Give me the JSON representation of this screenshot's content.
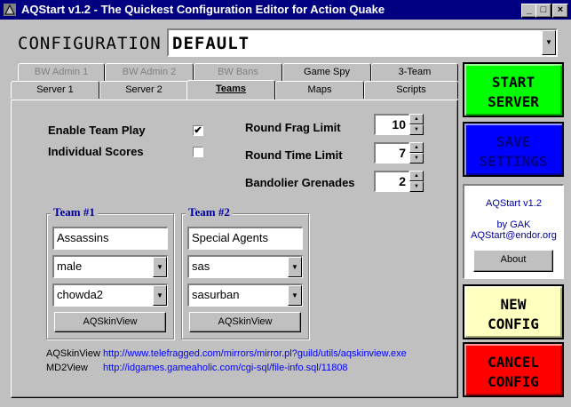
{
  "window": {
    "title": "AQStart v1.2 - The Quickest Configuration Editor for Action Quake",
    "minimize_icon": "minimize-icon",
    "maximize_icon": "maximize-icon",
    "close_icon": "close-icon"
  },
  "configuration": {
    "label": "CONFIGURATION",
    "value": "DEFAULT"
  },
  "tabs": {
    "row_back": [
      "BW Admin 1",
      "BW Admin 2",
      "BW Bans",
      "Game Spy",
      "3-Team"
    ],
    "row_front": [
      "Server 1",
      "Server 2",
      "Teams",
      "Maps",
      "Scripts"
    ],
    "active": "Teams"
  },
  "teams": {
    "enable_team_play_label": "Enable Team Play",
    "enable_team_play_checked": true,
    "individual_scores_label": "Individual Scores",
    "individual_scores_checked": false,
    "round_frag_limit_label": "Round Frag Limit",
    "round_frag_limit": "10",
    "round_time_limit_label": "Round Time Limit",
    "round_time_limit": "7",
    "bandolier_grenades_label": "Bandolier Grenades",
    "bandolier_grenades": "2",
    "team1": {
      "title": "Team #1",
      "name": "Assassins",
      "model": "male",
      "skin": "chowda2",
      "skinview_button": "AQSkinView"
    },
    "team2": {
      "title": "Team #2",
      "name": "Special Agents",
      "model": "sas",
      "skin": "sasurban",
      "skinview_button": "AQSkinView"
    },
    "links": [
      {
        "name": "AQSkinView",
        "url": "http://www.telefragged.com/mirrors/mirror.pl?guild/utils/aqskinview.exe"
      },
      {
        "name": "MD2View",
        "url": "http://idgames.gameaholic.com/cgi-sql/file-info.sql/11808"
      }
    ]
  },
  "side": {
    "start_server": [
      "START",
      "SERVER"
    ],
    "save_settings": [
      "SAVE",
      "SETTINGS"
    ],
    "info": {
      "version": "AQStart v1.2",
      "by": "by GAK",
      "email": "AQStart@endor.org",
      "about_button": "About"
    },
    "new_config": [
      "NEW",
      "CONFIG"
    ],
    "cancel_config": [
      "CANCEL",
      "CONFIG"
    ]
  },
  "colors": {
    "title_bar": "#000080",
    "start": "#00ff00",
    "save": "#0000ff",
    "save_text": "#000080",
    "new": "#ffffc0",
    "cancel": "#ff0000",
    "group_title": "#0000a0",
    "link": "#0000ff"
  }
}
